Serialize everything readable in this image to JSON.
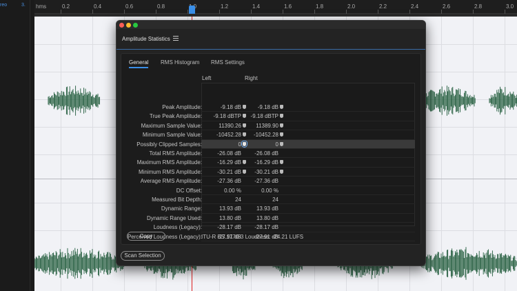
{
  "track": {
    "label": "reo",
    "number": "3."
  },
  "ruler": {
    "unit": "hms",
    "ticks": [
      "0.2",
      "0.4",
      "0.6",
      "0.8",
      "1.0",
      "1.2",
      "1.4",
      "1.6",
      "1.8",
      "2.0",
      "2.2",
      "2.4",
      "2.6",
      "2.8",
      "3.0"
    ]
  },
  "panel": {
    "title": "Amplitude Statistics",
    "tabs": [
      "General",
      "RMS Histogram",
      "RMS Settings"
    ],
    "active_tab": "General",
    "columns": {
      "left": "Left",
      "right": "Right"
    },
    "rows": [
      {
        "label": "Peak Amplitude:",
        "left": "-9.18 dB",
        "right": "-9.18 dB",
        "pins": true
      },
      {
        "label": "True Peak Amplitude:",
        "left": "-9.18 dBTP",
        "right": "-9.18 dBTP",
        "pins": true
      },
      {
        "label": "Maximum Sample Value:",
        "left": "11390.26",
        "right": "11389.90",
        "pins": true
      },
      {
        "label": "Minimum Sample Value:",
        "left": "-10452.28",
        "right": "-10452.28",
        "pins": true
      },
      {
        "label": "Possibly Clipped Samples:",
        "left": "0",
        "right": "0",
        "pins": true,
        "highlighted": true
      },
      {
        "label": "Total RMS Amplitude:",
        "left": "-26.08 dB",
        "right": "-26.08 dB",
        "pins": false
      },
      {
        "label": "Maximum RMS Amplitude:",
        "left": "-16.29 dB",
        "right": "-16.29 dB",
        "pins": true
      },
      {
        "label": "Minimum RMS Amplitude:",
        "left": "-30.21 dB",
        "right": "-30.21 dB",
        "pins": true
      },
      {
        "label": "Average RMS Amplitude:",
        "left": "-27.36 dB",
        "right": "-27.36 dB",
        "pins": false
      },
      {
        "label": "DC Offset:",
        "left": "0.00 %",
        "right": "0.00 %",
        "pins": false
      },
      {
        "label": "Measured Bit Depth:",
        "left": "24",
        "right": "24",
        "pins": false
      },
      {
        "label": "Dynamic Range:",
        "left": "13.93 dB",
        "right": "13.93 dB",
        "pins": false
      },
      {
        "label": "Dynamic Range Used:",
        "left": "13.80 dB",
        "right": "13.80 dB",
        "pins": false
      },
      {
        "label": "Loudness (Legacy):",
        "left": "-28.17 dB",
        "right": "-28.17 dB",
        "pins": false
      },
      {
        "label": "Perceived Loudness (Legacy):",
        "left": "-27.91 dB",
        "right": "-27.91 dB",
        "pins": false
      }
    ],
    "copy_label": "Copy",
    "loudness_text": "ITU-R BS.1770-3 Loudness: -24.21 LUFS"
  },
  "scan_selection_label": "Scan Selection",
  "colors": {
    "accent": "#3a8fe8",
    "waveform": "#1f5a3a",
    "playhead": "#e02020",
    "wave_background": "#f1f2f6"
  }
}
